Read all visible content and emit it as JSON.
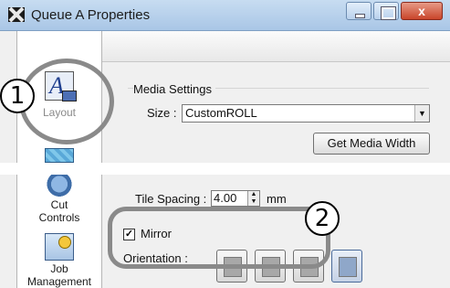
{
  "window": {
    "title": "Queue A Properties",
    "close_glyph": "x"
  },
  "sidebar": {
    "items": [
      {
        "label": "Layout",
        "icon": "layout-icon"
      },
      {
        "label": "Cut\nControls",
        "icon": "cut-controls-icon"
      },
      {
        "label": "Job\nManagement",
        "icon": "job-management-icon"
      }
    ]
  },
  "media_settings": {
    "group_label": "Media Settings",
    "size_label": "Size :",
    "size_value": "CustomROLL",
    "get_width_button": "Get Media Width"
  },
  "tile": {
    "label": "Tile Spacing :",
    "value": "4.00",
    "unit": "mm"
  },
  "mirror": {
    "label": "Mirror",
    "checked": true,
    "check_glyph": "✓"
  },
  "orientation": {
    "label": "Orientation :"
  },
  "callouts": {
    "one": "1",
    "two": "2"
  }
}
